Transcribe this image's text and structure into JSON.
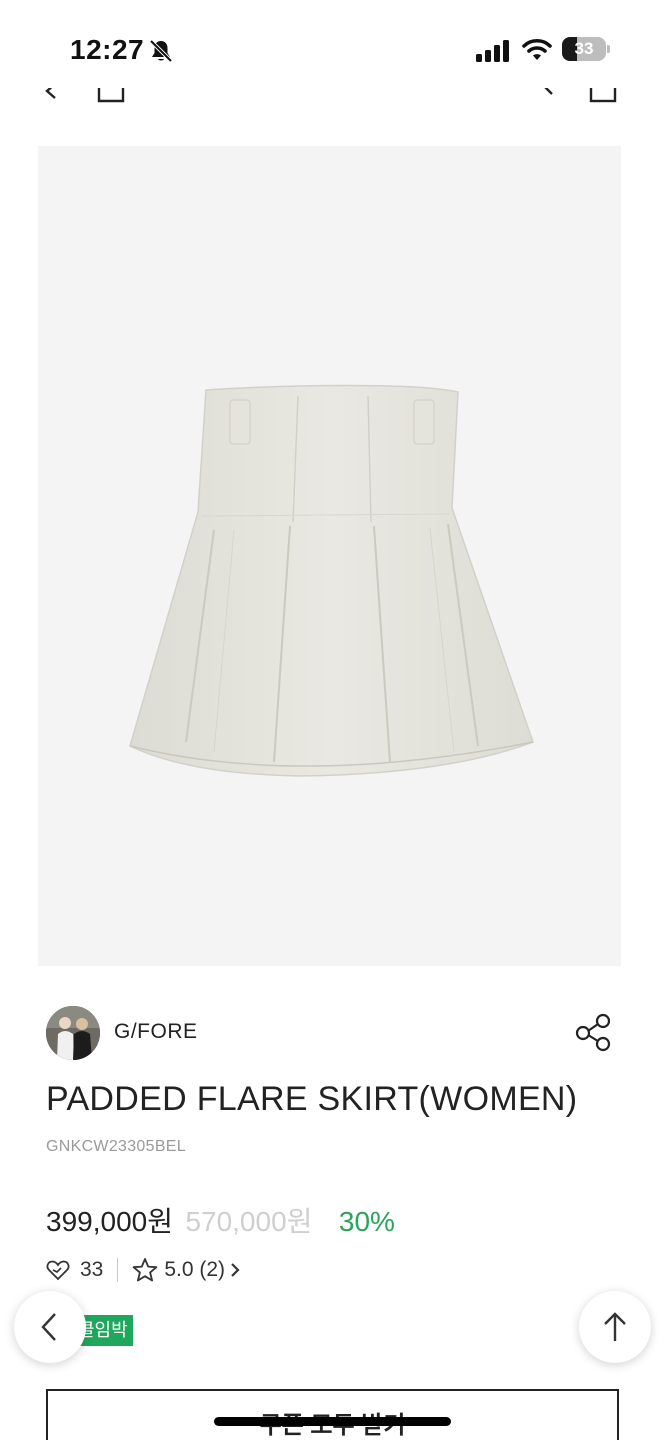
{
  "status_bar": {
    "time": "12:27",
    "battery_level": "33",
    "battery_fraction": 0.33,
    "icons": [
      "bell-off-icon",
      "signal-icon",
      "wifi-icon",
      "battery-icon"
    ]
  },
  "nav": {
    "icons": [
      "back-icon",
      "home-icon",
      "search-icon",
      "shopping-bag-icon"
    ]
  },
  "product": {
    "image_alt": "padded-flare-skirt-image",
    "brand": "G/FORE",
    "title": "PADDED FLARE SKIRT(WOMEN)",
    "code": "GNKCW23305BEL",
    "price": "399,000원",
    "original_price": "570,000원",
    "discount": "30%",
    "likes": "33",
    "rating": "5.0 (2)",
    "badge": "클임박"
  },
  "actions": {
    "coupon_label": "쿠폰 모두 받기"
  },
  "colors": {
    "accent_green": "#1fa75d",
    "discount_green": "#2aa45c",
    "strike_gray": "#cfcfcf"
  }
}
